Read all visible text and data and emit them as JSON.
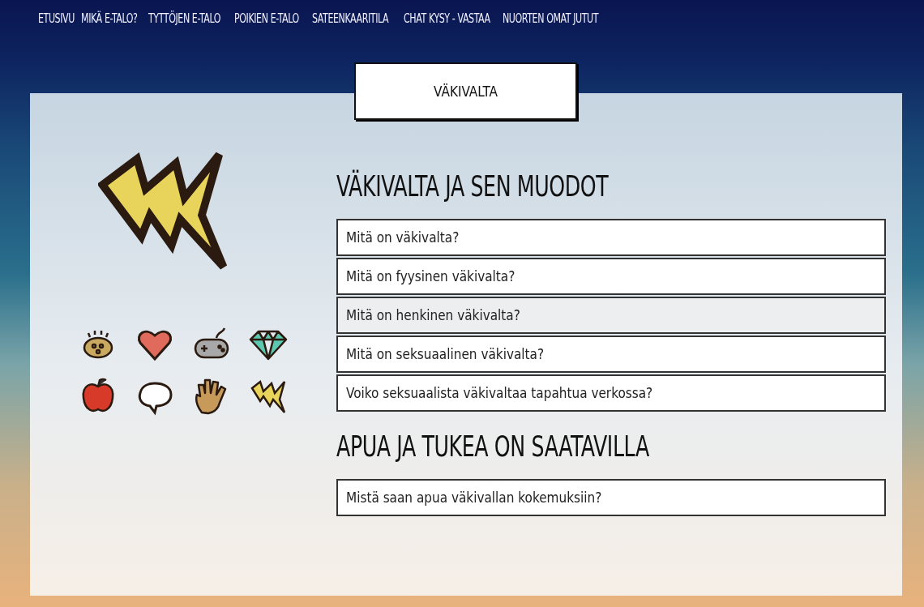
{
  "nav": [
    "ETUSIVU",
    "MIKÄ E-TALO?",
    "TYTTÖJEN E-TALO",
    "POIKIEN E-TALO",
    "SATEENKAARITILA",
    "CHAT",
    "KYSY - VASTAA",
    "NUORTEN OMAT JUTUT"
  ],
  "page_tab": "VÄKIVALTA",
  "sections": [
    {
      "heading": "VÄKIVALTA JA SEN MUODOT",
      "items": [
        {
          "label": "Mitä on väkivalta?",
          "hovered": false
        },
        {
          "label": "Mitä on fyysinen väkivalta?",
          "hovered": false
        },
        {
          "label": "Mitä on henkinen väkivalta?",
          "hovered": true
        },
        {
          "label": "Mitä on seksuaalinen väkivalta?",
          "hovered": false
        },
        {
          "label": "Voiko seksuaalista väkivaltaa tapahtua verkossa?",
          "hovered": false
        }
      ]
    },
    {
      "heading": "APUA JA TUKEA ON SAATAVILLA",
      "items": [
        {
          "label": "Mistä saan apua väkivallan kokemuksiin?",
          "hovered": false
        }
      ]
    }
  ]
}
